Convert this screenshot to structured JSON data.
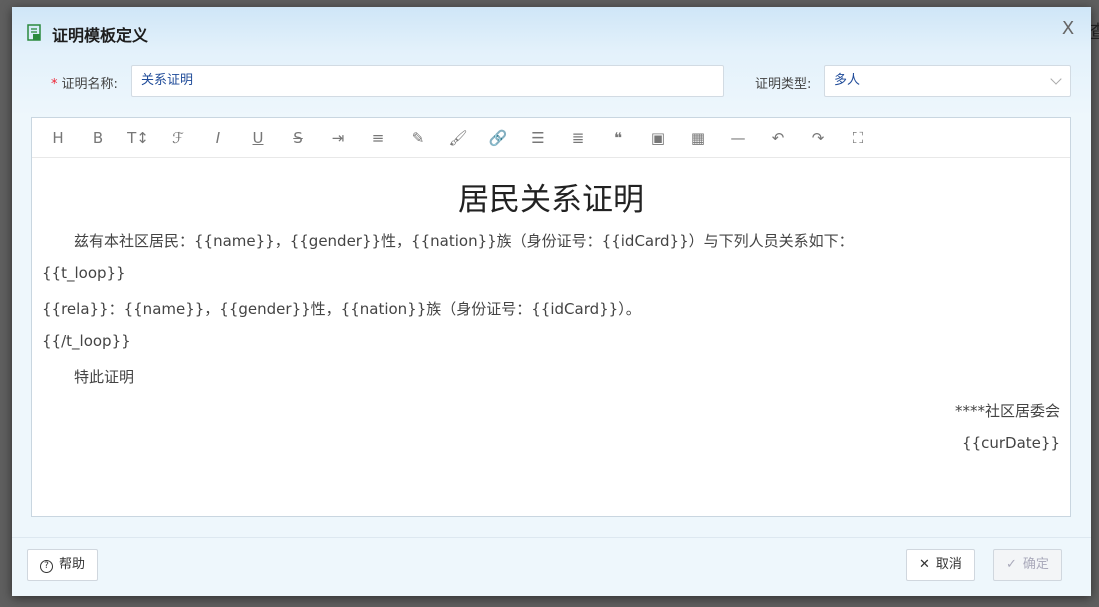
{
  "background_glyph": "查",
  "dialog": {
    "title": "证明模板定义",
    "close_glyph": "X"
  },
  "form": {
    "name_label": "证明名称:",
    "name_value": "关系证明",
    "type_label": "证明类型:",
    "type_value": "多人"
  },
  "toolbar": [
    {
      "name": "heading-icon",
      "glyph": "H"
    },
    {
      "name": "bold-icon",
      "glyph": "B"
    },
    {
      "name": "font-size-icon",
      "glyph": "T↕"
    },
    {
      "name": "font-family-icon",
      "glyph": "ℱ"
    },
    {
      "name": "italic-icon",
      "glyph": "I"
    },
    {
      "name": "underline-icon",
      "glyph": "U"
    },
    {
      "name": "strikethrough-icon",
      "glyph": "S"
    },
    {
      "name": "indent-icon",
      "glyph": "⇥"
    },
    {
      "name": "line-height-icon",
      "glyph": "≡"
    },
    {
      "name": "font-color-icon",
      "glyph": "✎"
    },
    {
      "name": "background-color-icon",
      "glyph": "🖌"
    },
    {
      "name": "link-icon",
      "glyph": "🔗"
    },
    {
      "name": "list-icon",
      "glyph": "☰"
    },
    {
      "name": "align-icon",
      "glyph": "≣"
    },
    {
      "name": "quote-icon",
      "glyph": "❝"
    },
    {
      "name": "image-icon",
      "glyph": "▣"
    },
    {
      "name": "table-icon",
      "glyph": "▦"
    },
    {
      "name": "divider-icon",
      "glyph": "—"
    },
    {
      "name": "undo-icon",
      "glyph": "↶"
    },
    {
      "name": "redo-icon",
      "glyph": "↷"
    },
    {
      "name": "fullscreen-icon",
      "glyph": "⛶"
    }
  ],
  "document": {
    "title": "居民关系证明",
    "para1": "兹有本社区居民：{{name}}，{{gender}}性，{{nation}}族（身份证号：{{idCard}}）与下列人员关系如下：",
    "loop_start": "{{t_loop}}",
    "rela_line": "{{rela}}：{{name}}，{{gender}}性，{{nation}}族（身份证号：{{idCard}}）。",
    "loop_end": "{{/t_loop}}",
    "closing": "特此证明",
    "signature": "****社区居委会",
    "date": "{{curDate}}"
  },
  "footer": {
    "help_label": "帮助",
    "cancel_label": "取消",
    "confirm_label": "确定"
  },
  "colors": {
    "accent": "#1f4b99",
    "required": "#e23",
    "header_gradient_top": "#cfe6f7"
  }
}
